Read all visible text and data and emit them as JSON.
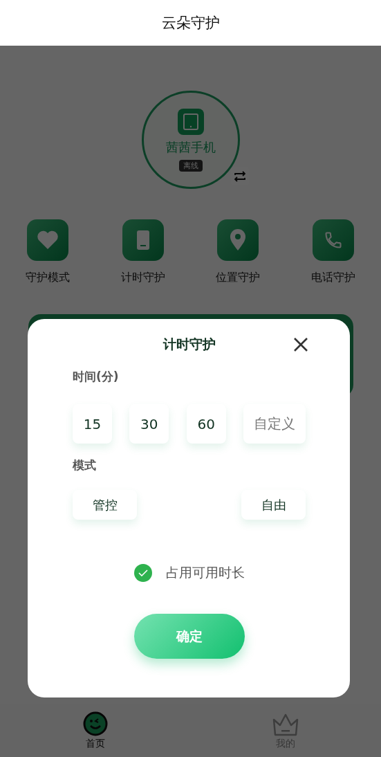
{
  "header": {
    "title": "云朵守护"
  },
  "device": {
    "name": "茜茜手机",
    "status": "离线"
  },
  "features": [
    {
      "kind": "heart",
      "label": "守护模式"
    },
    {
      "kind": "timer",
      "label": "计时守护"
    },
    {
      "kind": "location",
      "label": "位置守护"
    },
    {
      "kind": "phone",
      "label": "电话守护"
    }
  ],
  "dialog": {
    "title": "计时守护",
    "time_label": "时间(分)",
    "time_options": [
      {
        "label": "15",
        "kind": "preset",
        "selected": false
      },
      {
        "label": "30",
        "kind": "preset",
        "selected": false
      },
      {
        "label": "60",
        "kind": "preset",
        "selected": false
      },
      {
        "label": "自定义",
        "kind": "custom",
        "selected": false
      }
    ],
    "mode_label": "模式",
    "modes": [
      {
        "label": "管控",
        "selected": false
      },
      {
        "label": "自由",
        "selected": false
      }
    ],
    "occupy": {
      "label": "占用可用时长",
      "checked": true
    },
    "confirm": "确定"
  },
  "tabs": [
    {
      "label": "首页",
      "kind": "home",
      "selected": true
    },
    {
      "label": "我的",
      "kind": "mine",
      "selected": false
    }
  ]
}
